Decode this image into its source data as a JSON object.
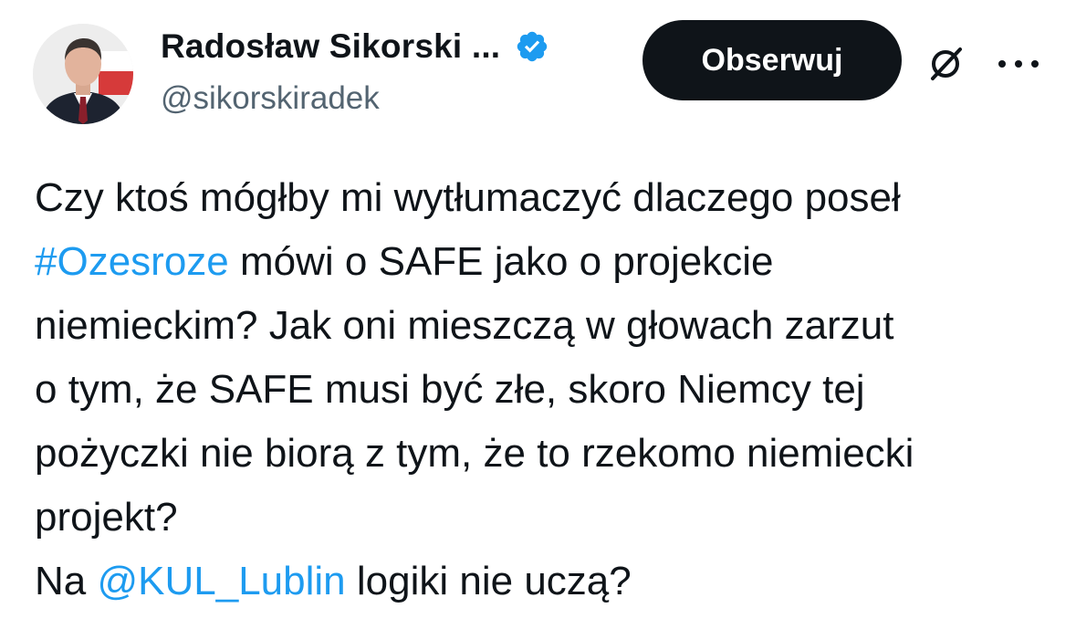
{
  "author": {
    "display_name": "Radosław Sikorski ...",
    "handle": "@sikorskiradek",
    "verified_icon": "verified-badge-icon",
    "verified_color": "#1d9bf0"
  },
  "actions": {
    "follow_label": "Obserwuj",
    "grok_icon": "grok-icon",
    "more_icon": "more-options-icon"
  },
  "tweet": {
    "line1": "Czy ktoś mógłby mi wytłumaczyć dlaczego poseł",
    "line2_hashtag": "#Ozesroze",
    "line2_rest": " mówi o SAFE jako o projekcie",
    "line3": "niemieckim?  Jak oni mieszczą w głowach zarzut",
    "line4": "o tym, że SAFE musi być złe, skoro Niemcy tej",
    "line5": "pożyczki nie biorą z tym, że to rzekomo niemiecki",
    "line6": "projekt?",
    "line7_prefix": "Na ",
    "line7_mention": "@KUL_Lublin",
    "line7_rest": " logiki nie uczą?"
  },
  "colors": {
    "text": "#0f1419",
    "secondary": "#536471",
    "link": "#1d9bf0",
    "button_bg": "#0f1419",
    "button_text": "#ffffff"
  }
}
